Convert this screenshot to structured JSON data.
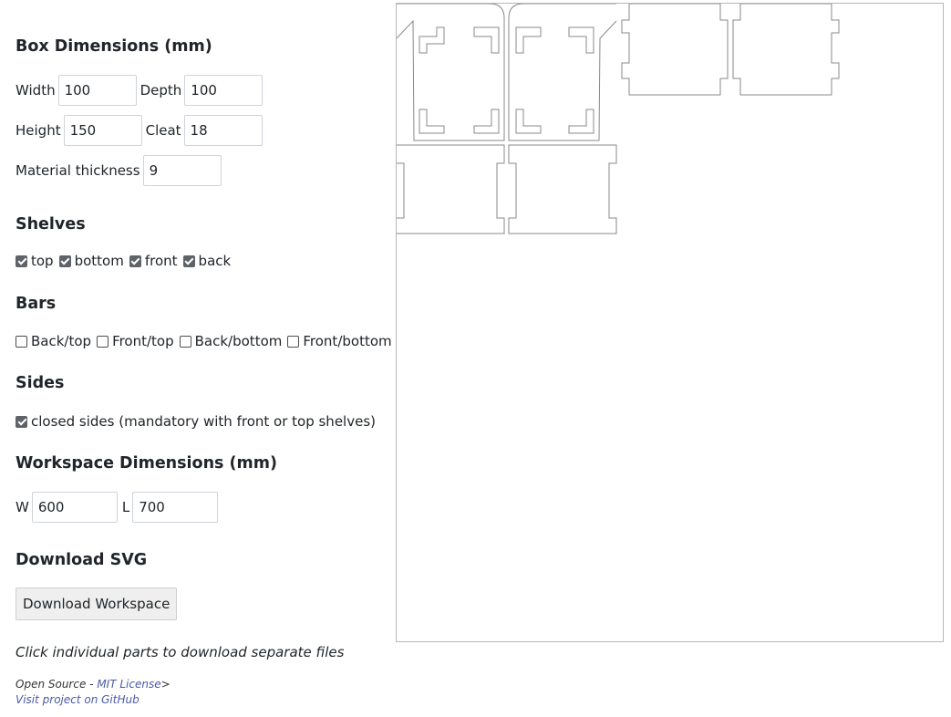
{
  "box_dimensions": {
    "heading": "Box Dimensions (mm)",
    "width_label": "Width",
    "width_value": "100",
    "depth_label": "Depth",
    "depth_value": "100",
    "height_label": "Height",
    "height_value": "150",
    "cleat_label": "Cleat",
    "cleat_value": "18",
    "thickness_label": "Material thickness",
    "thickness_value": "9"
  },
  "shelves": {
    "heading": "Shelves",
    "items": [
      {
        "label": "top",
        "checked": true
      },
      {
        "label": "bottom",
        "checked": true
      },
      {
        "label": "front",
        "checked": true
      },
      {
        "label": "back",
        "checked": true
      }
    ]
  },
  "bars": {
    "heading": "Bars",
    "items": [
      {
        "label": "Back/top",
        "checked": false
      },
      {
        "label": "Front/top",
        "checked": false
      },
      {
        "label": "Back/bottom",
        "checked": false
      },
      {
        "label": "Front/bottom",
        "checked": false
      }
    ]
  },
  "sides": {
    "heading": "Sides",
    "closed_label": "closed sides (mandatory with front or top shelves)",
    "closed_checked": true
  },
  "workspace_dimensions": {
    "heading": "Workspace Dimensions (mm)",
    "w_label": "W",
    "w_value": "600",
    "l_label": "L",
    "l_value": "700"
  },
  "download": {
    "heading": "Download SVG",
    "button_label": "Download Workspace",
    "hint": "Click individual parts to download separate files"
  },
  "footer": {
    "open_source": "Open Source - ",
    "license_link": "MIT License",
    "license_suffix": ">",
    "github_link": "Visit project on GitHub"
  },
  "colors": {
    "outline": "#8a8a8a",
    "cleat_red": "#d9381e",
    "cleat_blue": "#1a1aff",
    "cleat_green": "#4a7a1a",
    "cleat_yellow": "#e8a820",
    "link": "#4a5aa8"
  }
}
